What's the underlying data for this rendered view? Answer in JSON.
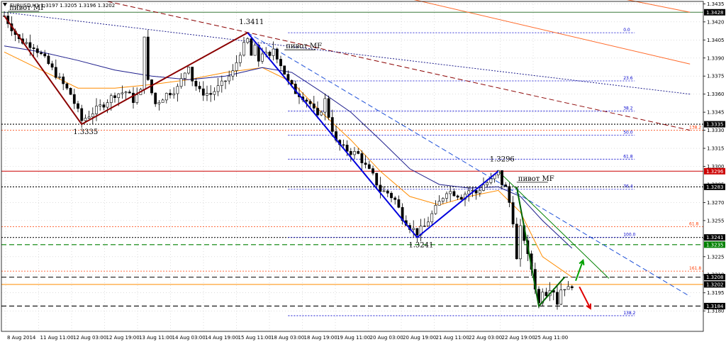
{
  "chart_data": {
    "type": "candlestick",
    "title": "EURUSD,H1  1.3197 1.3205 1.3196 1.3202",
    "ylim": [
      1.3163,
      1.3437
    ],
    "y_ticks": [
      1.318,
      1.3195,
      1.321,
      1.3225,
      1.324,
      1.3255,
      1.327,
      1.3285,
      1.33,
      1.3315,
      1.333,
      1.3345,
      1.336,
      1.3375,
      1.339,
      1.3405,
      1.342,
      1.3435
    ],
    "y_tick_labels": [
      "1.3180",
      "1.3195",
      "1.3210",
      "1.3225",
      "1.3240",
      "1.3255",
      "1.3270",
      "1.3285",
      "1.3300",
      "1.3315",
      "1.3330",
      "1.3345",
      "1.3360",
      "1.3375",
      "1.3390",
      "1.3405",
      "1.3420",
      "1.3435"
    ],
    "x_labels": [
      "8 Aug 2014",
      "11 Aug 11:00",
      "12 Aug 03:00",
      "12 Aug 19:00",
      "13 Aug 11:00",
      "14 Aug 03:00",
      "14 Aug 19:00",
      "15 Aug 11:00",
      "18 Aug 03:00",
      "18 Aug 19:00",
      "19 Aug 11:00",
      "20 Aug 03:00",
      "20 Aug 19:00",
      "21 Aug 11:00",
      "22 Aug 03:00",
      "22 Aug 19:00",
      "25 Aug 11:00"
    ],
    "grid": true,
    "price_path": [
      [
        0,
        1.3425
      ],
      [
        4,
        1.3405
      ],
      [
        8,
        1.34
      ],
      [
        12,
        1.3385
      ],
      [
        15,
        1.3372
      ],
      [
        18,
        1.336
      ],
      [
        21,
        1.3338
      ],
      [
        24,
        1.3345
      ],
      [
        27,
        1.3352
      ],
      [
        30,
        1.336
      ],
      [
        33,
        1.3362
      ],
      [
        35,
        1.3355
      ],
      [
        37,
        1.3362
      ],
      [
        38,
        1.341
      ],
      [
        39,
        1.337
      ],
      [
        41,
        1.3352
      ],
      [
        44,
        1.336
      ],
      [
        47,
        1.3365
      ],
      [
        50,
        1.3385
      ],
      [
        51,
        1.3372
      ],
      [
        53,
        1.3362
      ],
      [
        56,
        1.336
      ],
      [
        59,
        1.3368
      ],
      [
        62,
        1.3378
      ],
      [
        64,
        1.3395
      ],
      [
        66,
        1.3405
      ],
      [
        67,
        1.3392
      ],
      [
        68,
        1.3398
      ],
      [
        69,
        1.3388
      ],
      [
        70,
        1.3395
      ],
      [
        72,
        1.339
      ],
      [
        73,
        1.3398
      ],
      [
        75,
        1.3385
      ],
      [
        77,
        1.337
      ],
      [
        79,
        1.3362
      ],
      [
        81,
        1.3358
      ],
      [
        83,
        1.3352
      ],
      [
        85,
        1.334
      ],
      [
        87,
        1.3355
      ],
      [
        88,
        1.3342
      ],
      [
        90,
        1.332
      ],
      [
        92,
        1.3315
      ],
      [
        94,
        1.3312
      ],
      [
        96,
        1.331
      ],
      [
        98,
        1.33
      ],
      [
        100,
        1.3292
      ],
      [
        102,
        1.328
      ],
      [
        104,
        1.3278
      ],
      [
        106,
        1.3272
      ],
      [
        108,
        1.3258
      ],
      [
        110,
        1.325
      ],
      [
        112,
        1.3245
      ],
      [
        114,
        1.325
      ],
      [
        116,
        1.326
      ],
      [
        118,
        1.327
      ],
      [
        120,
        1.328
      ],
      [
        122,
        1.3278
      ],
      [
        124,
        1.3275
      ],
      [
        126,
        1.328
      ],
      [
        128,
        1.3278
      ],
      [
        130,
        1.3285
      ],
      [
        132,
        1.3288
      ],
      [
        134,
        1.3295
      ],
      [
        135,
        1.3286
      ],
      [
        136,
        1.3282
      ],
      [
        137,
        1.327
      ],
      [
        138,
        1.3255
      ],
      [
        139,
        1.3222
      ],
      [
        140,
        1.3248
      ],
      [
        141,
        1.324
      ],
      [
        142,
        1.3225
      ],
      [
        143,
        1.3215
      ],
      [
        144,
        1.32
      ],
      [
        145,
        1.3186
      ],
      [
        146,
        1.3198
      ],
      [
        147,
        1.3195
      ],
      [
        148,
        1.32
      ],
      [
        149,
        1.3197
      ],
      [
        150,
        1.3187
      ],
      [
        151,
        1.3198
      ],
      [
        152,
        1.32
      ],
      [
        153,
        1.3198
      ],
      [
        154,
        1.3202
      ]
    ],
    "moving_averages": [
      {
        "color": "#ff8c00",
        "values": [
          [
            0,
            1.3395
          ],
          [
            10,
            1.338
          ],
          [
            20,
            1.3365
          ],
          [
            30,
            1.3365
          ],
          [
            40,
            1.3368
          ],
          [
            50,
            1.3372
          ],
          [
            60,
            1.3378
          ],
          [
            70,
            1.3382
          ],
          [
            78,
            1.337
          ],
          [
            86,
            1.3345
          ],
          [
            94,
            1.3322
          ],
          [
            102,
            1.3296
          ],
          [
            110,
            1.3275
          ],
          [
            118,
            1.3268
          ],
          [
            126,
            1.3275
          ],
          [
            134,
            1.328
          ],
          [
            140,
            1.3262
          ],
          [
            146,
            1.3225
          ],
          [
            154,
            1.3208
          ]
        ]
      },
      {
        "color": "#1e1e8c",
        "values": [
          [
            0,
            1.34
          ],
          [
            10,
            1.3395
          ],
          [
            20,
            1.3388
          ],
          [
            30,
            1.338
          ],
          [
            40,
            1.3375
          ],
          [
            50,
            1.3372
          ],
          [
            60,
            1.3375
          ],
          [
            70,
            1.3382
          ],
          [
            78,
            1.3378
          ],
          [
            86,
            1.3362
          ],
          [
            94,
            1.3345
          ],
          [
            102,
            1.3322
          ],
          [
            110,
            1.3298
          ],
          [
            118,
            1.3285
          ],
          [
            126,
            1.3282
          ],
          [
            134,
            1.3283
          ],
          [
            140,
            1.3275
          ],
          [
            146,
            1.3255
          ],
          [
            154,
            1.3232
          ]
        ]
      }
    ],
    "horizontal_levels": [
      {
        "price": 1.3428,
        "color": "#3c7a3c",
        "style": "solid",
        "badge": "1.3428",
        "badge_color": "#000000"
      },
      {
        "price": 1.3335,
        "color": "#000000",
        "style": "dotted",
        "badge": "1.3335",
        "badge_color": "#000000"
      },
      {
        "price": 1.3296,
        "color": "#cc0000",
        "style": "solid",
        "badge": "1.3296",
        "badge_color": "#cc0000"
      },
      {
        "price": 1.3283,
        "color": "#000000",
        "style": "dotted",
        "badge": "1.3283",
        "badge_color": "#000000"
      },
      {
        "price": 1.3241,
        "color": "#000000",
        "style": "dotted",
        "badge": "1.3241",
        "badge_color": "#000000"
      },
      {
        "price": 1.3235,
        "color": "#008000",
        "style": "dashed",
        "badge": "1.3235",
        "badge_color": "#008000"
      },
      {
        "price": 1.3208,
        "color": "#000000",
        "style": "dashed",
        "badge": "1.3208",
        "badge_color": "#000000"
      },
      {
        "price": 1.3202,
        "color": "#ff8c00",
        "style": "solid",
        "badge": "1.3202",
        "badge_color": "#000000"
      },
      {
        "price": 1.3184,
        "color": "#000000",
        "style": "dashed",
        "badge": "1.3184",
        "badge_color": "#000000"
      }
    ],
    "fibonacci_levels": [
      {
        "label": "0.0",
        "price": 1.3411,
        "color": "#0000cc"
      },
      {
        "label": "23.6",
        "price": 1.3371,
        "color": "#0000cc"
      },
      {
        "label": "38.2",
        "price": 1.3346,
        "color": "#0000cc"
      },
      {
        "label": "50.0",
        "price": 1.3326,
        "color": "#0000cc"
      },
      {
        "label": "61.8",
        "price": 1.3306,
        "color": "#0000cc"
      },
      {
        "label": "76.4",
        "price": 1.3281,
        "color": "#0000cc"
      },
      {
        "label": "100.0",
        "price": 1.3241,
        "color": "#0000cc"
      },
      {
        "label": "138.2",
        "price": 1.3176,
        "color": "#0000cc"
      }
    ],
    "extension_levels": [
      {
        "label": "138.2",
        "price": 1.333,
        "color": "#ff3b00"
      },
      {
        "label": "61.8",
        "price": 1.325,
        "color": "#ff3b00"
      },
      {
        "label": "161.8",
        "price": 1.3213,
        "color": "#ff3b00"
      }
    ],
    "price_annotations": [
      {
        "text": "1.3335",
        "bar": 21,
        "price": 1.3335
      },
      {
        "text": "1.3411",
        "bar": 66,
        "price": 1.3411
      },
      {
        "text": "1.3296",
        "bar": 134,
        "price": 1.3296
      },
      {
        "text": "1.3241",
        "bar": 112,
        "price": 1.3241
      }
    ],
    "text_annotations": [
      {
        "text": "пивот MF",
        "bar": 1,
        "price": 1.343
      },
      {
        "text": "пивот MF",
        "bar": 76,
        "price": 1.3398
      },
      {
        "text": "пивот MF",
        "bar": 139,
        "price": 1.3288
      }
    ],
    "zigzag": [
      {
        "color": "#8b0000",
        "points": [
          [
            0,
            1.3425
          ],
          [
            21,
            1.3335
          ],
          [
            66,
            1.3411
          ]
        ]
      },
      {
        "color": "#0000dd",
        "points": [
          [
            66,
            1.3411
          ],
          [
            112,
            1.3241
          ],
          [
            134,
            1.3296
          ]
        ]
      },
      {
        "color": "#006400",
        "points": [
          [
            139,
            1.3283
          ],
          [
            145,
            1.3184
          ],
          [
            152,
            1.3208
          ]
        ]
      }
    ],
    "trend_lines": [
      {
        "color": "#8b0000",
        "style": "dashed",
        "points": [
          [
            28,
            1.3437
          ],
          [
            186,
            1.333
          ]
        ]
      },
      {
        "color": "#1e1e8c",
        "style": "dotted",
        "points": [
          [
            0,
            1.3428
          ],
          [
            186,
            1.336
          ]
        ]
      },
      {
        "color": "#ff6a2a",
        "style": "solid",
        "points": [
          [
            95,
            1.345
          ],
          [
            186,
            1.3385
          ]
        ]
      },
      {
        "color": "#ff6a2a",
        "style": "solid",
        "points": [
          [
            150,
            1.345
          ],
          [
            186,
            1.3428
          ]
        ]
      },
      {
        "color": "#1e50d8",
        "style": "dashed",
        "points": [
          [
            66,
            1.3411
          ],
          [
            186,
            1.3192
          ]
        ]
      },
      {
        "color": "#008000",
        "style": "solid",
        "points": [
          [
            134,
            1.3296
          ],
          [
            164,
            1.3207
          ]
        ]
      }
    ],
    "arrows": [
      {
        "color": "#00a000",
        "direction": "up",
        "from": [
          155,
          1.3205
        ],
        "to": [
          157,
          1.3222
        ]
      },
      {
        "color": "#e00000",
        "direction": "down",
        "from": [
          156,
          1.32
        ],
        "to": [
          159,
          1.3182
        ]
      }
    ]
  }
}
